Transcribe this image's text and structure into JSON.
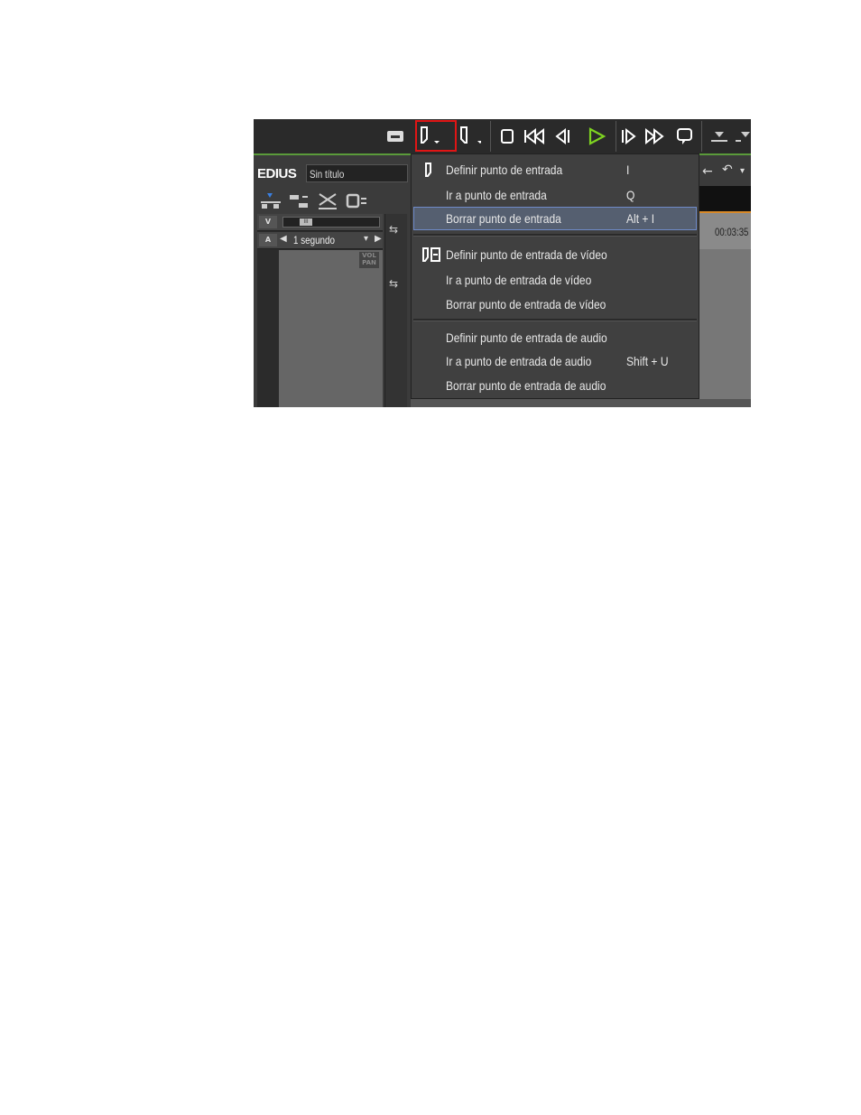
{
  "app": {
    "logo": "EDIUS",
    "project_title": "Sin título"
  },
  "toolbar": {
    "buttons": [
      {
        "name": "sync-lock-icon"
      },
      {
        "name": "mark-in-icon"
      },
      {
        "name": "mark-out-icon"
      },
      {
        "name": "stop-icon"
      },
      {
        "name": "rewind-icon"
      },
      {
        "name": "step-back-icon"
      },
      {
        "name": "play-icon",
        "color": "#7ed321"
      },
      {
        "name": "step-forward-icon"
      },
      {
        "name": "fast-forward-icon"
      },
      {
        "name": "loop-icon"
      },
      {
        "name": "insert-icon"
      },
      {
        "name": "overwrite-icon"
      }
    ]
  },
  "timeline": {
    "scale_label": "1 segundo",
    "vol_pan_label": "VOL PAN",
    "timecode": "00:03:35"
  },
  "menu": {
    "groups": [
      {
        "items": [
          {
            "label": "Definir punto de entrada",
            "shortcut": "I",
            "icon": "mark-in-icon"
          },
          {
            "label": "Ir a punto de entrada",
            "shortcut": "Q"
          },
          {
            "label": "Borrar punto de entrada",
            "shortcut": "Alt + I",
            "highlighted": true
          }
        ]
      },
      {
        "items": [
          {
            "label": "Definir punto de entrada de vídeo",
            "shortcut": "",
            "icon": "video-mark-in-icon"
          },
          {
            "label": "Ir a punto de entrada de vídeo",
            "shortcut": ""
          },
          {
            "label": "Borrar punto de entrada de vídeo",
            "shortcut": ""
          }
        ]
      },
      {
        "items": [
          {
            "label": "Definir punto de entrada de audio",
            "shortcut": ""
          },
          {
            "label": "Ir a punto de entrada de audio",
            "shortcut": "Shift + U"
          },
          {
            "label": "Borrar punto de entrada de audio",
            "shortcut": ""
          }
        ]
      }
    ]
  },
  "colors": {
    "highlight_box": "#e01515",
    "menu_highlight": "#555f70",
    "play_green": "#7ed321"
  }
}
